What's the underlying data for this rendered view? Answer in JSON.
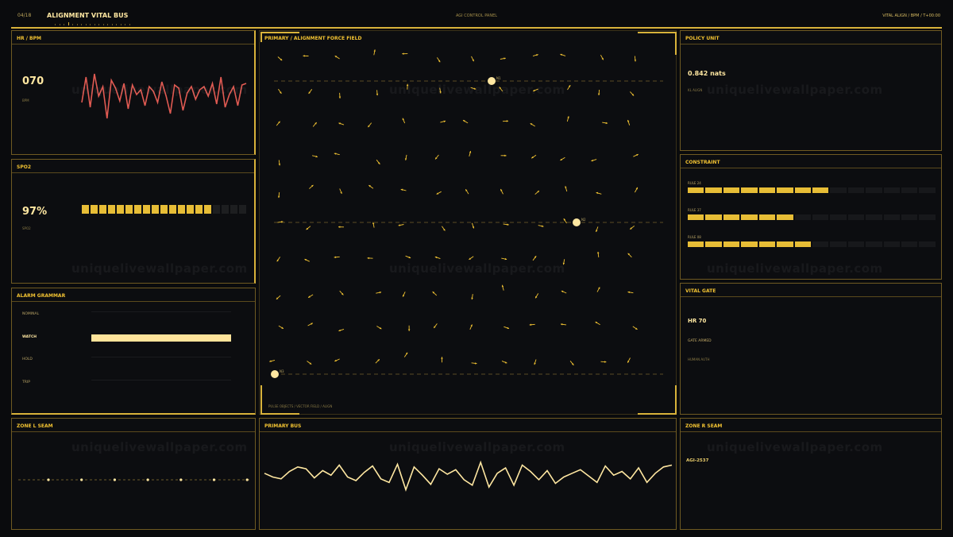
{
  "topbar": {
    "page": "04/18",
    "title": "ALIGNMENT VITAL BUS",
    "center": "AGI CONTROL PANEL",
    "right": "VITAL ALIGN  /  BPM  /  T+00:00"
  },
  "hr": {
    "title": "HR / BPM",
    "value": "070",
    "unit": "BPM",
    "color": "#e05a52",
    "series": [
      62,
      78,
      59,
      80,
      66,
      72,
      52,
      76,
      71,
      63,
      74,
      58,
      73,
      67,
      70,
      60,
      72,
      69,
      62,
      75,
      66,
      55,
      73,
      71,
      57,
      68,
      72,
      64,
      70,
      72,
      66,
      74,
      61,
      78,
      59,
      67,
      72,
      60,
      73,
      74
    ]
  },
  "spo2": {
    "title": "SPO2",
    "value": "97%",
    "unit": "SPO2",
    "filled": 15,
    "total": 19
  },
  "alarm": {
    "title": "ALARM GRAMMAR",
    "rows": [
      {
        "label": "NOMINAL",
        "active": false
      },
      {
        "label": "WATCH",
        "active": true
      },
      {
        "label": "HOLD",
        "active": false
      },
      {
        "label": "TRIP",
        "active": false
      }
    ]
  },
  "zoneL": {
    "title": "ZONE L SEAM",
    "dots": 7
  },
  "field": {
    "title": "PRIMARY  /  ALIGNMENT FORCE FIELD",
    "footer": "PULSE OBJECTS  /  VECTOR FIELD  /  ALIGN",
    "nodes": [
      {
        "label": "N1"
      },
      {
        "label": "N2"
      },
      {
        "label": "N3"
      }
    ]
  },
  "bus": {
    "title": "PRIMARY BUS",
    "color": "#ffe7a1",
    "series": [
      48,
      44,
      42,
      50,
      55,
      53,
      43,
      51,
      46,
      57,
      44,
      40,
      49,
      56,
      42,
      38,
      58,
      30,
      55,
      46,
      36,
      53,
      47,
      52,
      41,
      35,
      60,
      33,
      48,
      54,
      35,
      57,
      50,
      41,
      51,
      37,
      44,
      48,
      52,
      45,
      38,
      56,
      46,
      50,
      42,
      54,
      38,
      48,
      55,
      57
    ]
  },
  "policy": {
    "title": "POLICY UNIT",
    "value": "0.842 nats",
    "unit": "KL ALIGN"
  },
  "constraint": {
    "title": "CONSTRAINT",
    "rows": [
      {
        "label": "RULE 24",
        "filled": 8,
        "total": 14
      },
      {
        "label": "RULE 37",
        "filled": 6,
        "total": 14
      },
      {
        "label": "RULE 08",
        "filled": 7,
        "total": 14
      }
    ]
  },
  "gate": {
    "title": "VITAL GATE",
    "value": "HR 70",
    "status": "GATE ARMED",
    "auth": "HUMAN AUTH"
  },
  "zoneR": {
    "title": "ZONE R SEAM",
    "id": "AGI-2537"
  },
  "colors": {
    "accent": "#f1c232",
    "accent_dim": "#6f5a22",
    "bg": "#0a0b0d",
    "hr": "#e05a52"
  },
  "watermark": "uniquelivewallpaper.com"
}
